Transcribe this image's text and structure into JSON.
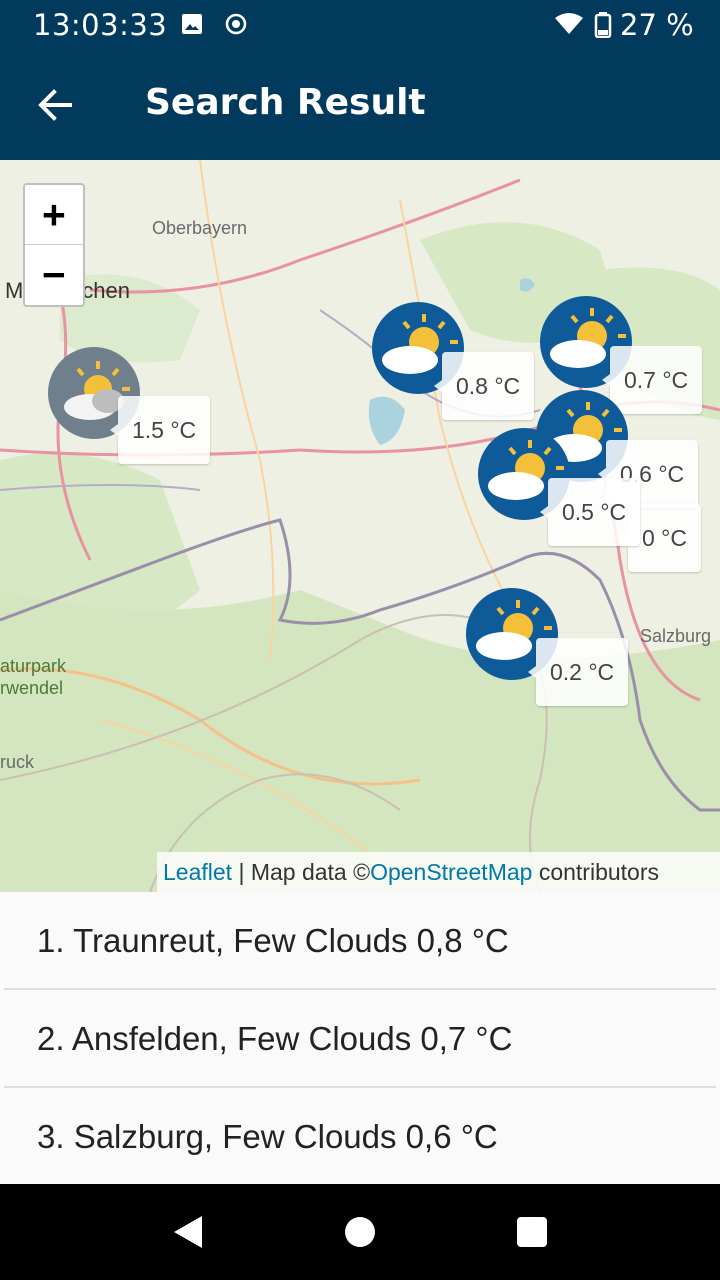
{
  "status": {
    "time": "13:03:33",
    "battery": "27 %"
  },
  "appbar": {
    "title": "Search Result"
  },
  "map": {
    "zoom_in": "+",
    "zoom_out": "−",
    "places": [
      "Oberbayern",
      "M",
      "nchen",
      "aturpark",
      "rwendel",
      "ruck",
      "Salzburg"
    ],
    "labels": [
      "1.5 °C",
      "0.8 °C",
      "0.7 °C",
      "0.6 °C",
      "0.5 °C",
      "0 °C",
      "0.2 °C"
    ],
    "attribution": {
      "leaflet": "Leaflet",
      "middle": " | Map data ©",
      "osm": "OpenStreetMap",
      "end": " contributors"
    }
  },
  "results": [
    "1. Traunreut, Few Clouds 0,8 °C",
    "2. Ansfelden, Few Clouds 0,7 °C",
    "3. Salzburg, Few Clouds 0,6 °C"
  ]
}
